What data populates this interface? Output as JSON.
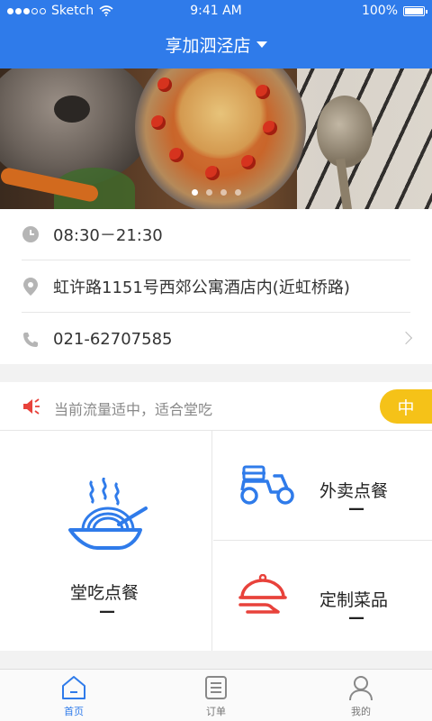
{
  "status_bar": {
    "carrier": "Sketch",
    "time": "9:41 AM",
    "battery": "100%"
  },
  "header": {
    "store_name": "享加泗泾店"
  },
  "banner": {
    "page_count": 4,
    "active_page": 1
  },
  "store_info": {
    "hours": "08:30－21:30",
    "address": "虹许路1151号西郊公寓酒店内(近虹桥路)",
    "phone": "021-62707585"
  },
  "notice": {
    "text": "当前流量适中，适合堂吃",
    "level": "中"
  },
  "services": {
    "dine_in": {
      "label": "堂吃点餐",
      "value": "—"
    },
    "takeout": {
      "label": "外卖点餐",
      "value": "—"
    },
    "custom": {
      "label": "定制菜品",
      "value": "—"
    }
  },
  "tabs": [
    {
      "label": "首页",
      "icon": "home-icon",
      "active": true
    },
    {
      "label": "订单",
      "icon": "order-list-icon",
      "active": false
    },
    {
      "label": "我的",
      "icon": "profile-icon",
      "active": false
    }
  ],
  "colors": {
    "primary": "#2f7bea",
    "badge": "#f5c218",
    "alert": "#e8423b"
  }
}
